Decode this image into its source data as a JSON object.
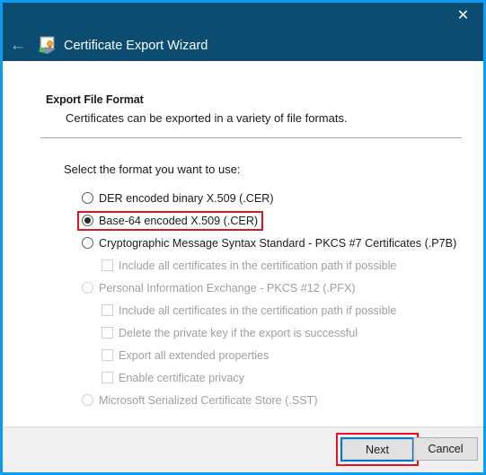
{
  "window": {
    "title": "Certificate Export Wizard",
    "close_label": "✕",
    "back_label": "←",
    "icon": "certificate-icon",
    "border_color": "#0b9bf0",
    "titlebar_color": "#0b4c70"
  },
  "page": {
    "heading": "Export File Format",
    "subheading": "Certificates can be exported in a variety of file formats.",
    "prompt": "Select the format you want to use:"
  },
  "options": [
    {
      "type": "radio",
      "label": "DER encoded binary X.509 (.CER)",
      "checked": false,
      "disabled": false,
      "indent": false,
      "highlighted": false
    },
    {
      "type": "radio",
      "label": "Base-64 encoded X.509 (.CER)",
      "checked": true,
      "disabled": false,
      "indent": false,
      "highlighted": true
    },
    {
      "type": "radio",
      "label": "Cryptographic Message Syntax Standard - PKCS #7 Certificates (.P7B)",
      "checked": false,
      "disabled": false,
      "indent": false,
      "highlighted": false
    },
    {
      "type": "checkbox",
      "label": "Include all certificates in the certification path if possible",
      "checked": false,
      "disabled": true,
      "indent": true,
      "highlighted": false
    },
    {
      "type": "radio",
      "label": "Personal Information Exchange - PKCS #12 (.PFX)",
      "checked": false,
      "disabled": true,
      "indent": false,
      "highlighted": false
    },
    {
      "type": "checkbox",
      "label": "Include all certificates in the certification path if possible",
      "checked": false,
      "disabled": true,
      "indent": true,
      "highlighted": false
    },
    {
      "type": "checkbox",
      "label": "Delete the private key if the export is successful",
      "checked": false,
      "disabled": true,
      "indent": true,
      "highlighted": false
    },
    {
      "type": "checkbox",
      "label": "Export all extended properties",
      "checked": false,
      "disabled": true,
      "indent": true,
      "highlighted": false
    },
    {
      "type": "checkbox",
      "label": "Enable certificate privacy",
      "checked": false,
      "disabled": true,
      "indent": true,
      "highlighted": false
    },
    {
      "type": "radio",
      "label": "Microsoft Serialized Certificate Store (.SST)",
      "checked": false,
      "disabled": true,
      "indent": false,
      "highlighted": false
    }
  ],
  "footer": {
    "next_label": "Next",
    "cancel_label": "Cancel",
    "focus_color": "#0078d7",
    "annotation_color": "#e81123"
  }
}
